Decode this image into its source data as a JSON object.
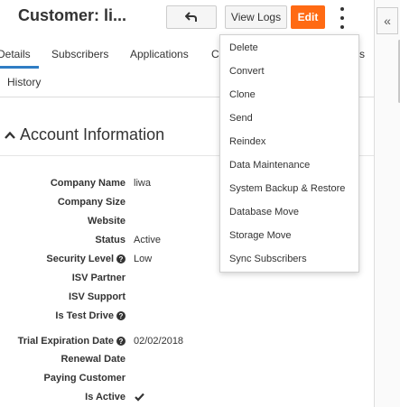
{
  "header": {
    "title": "Customer: li...",
    "view_logs_label": "View Logs",
    "edit_label": "Edit"
  },
  "collapse": {
    "label": "«"
  },
  "tabs": [
    {
      "label": "Details",
      "active": true
    },
    {
      "label": "Subscribers",
      "active": false
    },
    {
      "label": "Applications",
      "active": false
    },
    {
      "label": "C",
      "active": false
    },
    {
      "label": "s",
      "active": false
    },
    {
      "label": "History",
      "active": false
    }
  ],
  "section": {
    "title": "Account Information"
  },
  "fields": [
    {
      "label": "Company Name",
      "value": "liwa",
      "help": false
    },
    {
      "label": "Company Size",
      "value": "",
      "help": false
    },
    {
      "label": "Website",
      "value": "",
      "help": false
    },
    {
      "label": "Status",
      "value": "Active",
      "help": false
    },
    {
      "label": "Security Level",
      "value": "Low",
      "help": true
    },
    {
      "label": "ISV Partner",
      "value": "",
      "help": false
    },
    {
      "label": "ISV Support",
      "value": "",
      "help": false
    },
    {
      "label": "Is Test Drive",
      "value": "",
      "help": true
    },
    {
      "label": "Trial Expiration Date",
      "value": "02/02/2018",
      "help": true
    },
    {
      "label": "Renewal Date",
      "value": "",
      "help": false
    },
    {
      "label": "Paying Customer",
      "value": "",
      "help": false
    },
    {
      "label": "Is Active",
      "value": "",
      "help": false,
      "checked": true
    }
  ],
  "help_glyph": "?",
  "menu": {
    "items": [
      "Delete",
      "Convert",
      "Clone",
      "Send",
      "Reindex",
      "Data Maintenance",
      "System Backup & Restore",
      "Database Move",
      "Storage Move",
      "Sync Subscribers"
    ]
  },
  "colors": {
    "accent_orange": "#ff6a13",
    "tab_active_blue": "#2f7dc4",
    "text": "#333333"
  }
}
